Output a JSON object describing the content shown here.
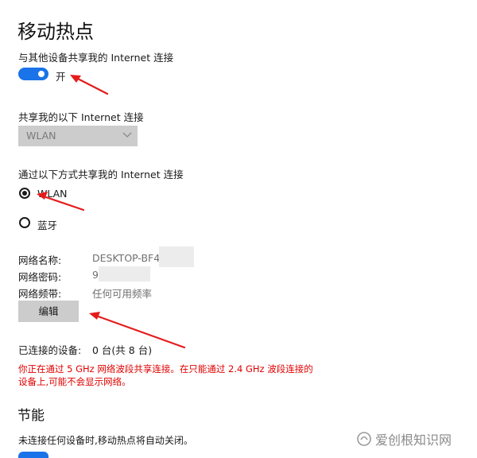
{
  "page": {
    "title": "移动热点",
    "share_label": "与其他设备共享我的 Internet 连接",
    "toggle_state": "开",
    "share_from_label": "共享我的以下 Internet 连接",
    "share_from_value": "WLAN",
    "share_over_label": "通过以下方式共享我的 Internet 连接",
    "options": [
      {
        "label": "WLAN",
        "checked": true
      },
      {
        "label": "蓝牙",
        "checked": false
      }
    ],
    "network": {
      "name_label": "网络名称:",
      "name_value": "DESKTOP-BF470",
      "password_label": "网络密码:",
      "password_value": "9",
      "band_label": "网络频带:",
      "band_value": "任何可用频率"
    },
    "edit_button": "编辑",
    "connected_label": "已连接的设备:",
    "connected_value": "0 台(共 8 台)",
    "warning_line1": "你正在通过 5 GHz 网络波段共享连接。在只能通过 2.4 GHz 波段连接的",
    "warning_line2": "设备上,可能不会显示网络。",
    "power_title": "节能",
    "power_desc": "未连接任何设备时,移动热点将自动关闭。"
  },
  "watermark": "爱创根知识网",
  "colors": {
    "accent": "#1a73e8",
    "warning": "#e00000",
    "annotation_arrow": "#e51b1b"
  }
}
